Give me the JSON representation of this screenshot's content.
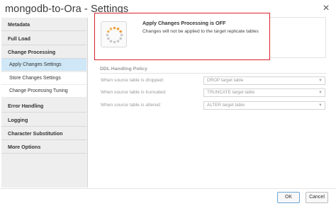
{
  "window": {
    "title": "mongodb-to-Ora - Settings",
    "close_glyph": "×"
  },
  "sidebar": {
    "items": [
      {
        "label": "Metadata"
      },
      {
        "label": "Full Load"
      },
      {
        "label": "Change Processing"
      },
      {
        "label": "Apply Changes Settings",
        "active": true
      },
      {
        "label": "Store Changes Settings"
      },
      {
        "label": "Change Processing Tuning"
      },
      {
        "label": "Error Handling"
      },
      {
        "label": "Logging"
      },
      {
        "label": "Character Substitution"
      },
      {
        "label": "More Options"
      }
    ]
  },
  "notice": {
    "title": "Apply Changes Processing is OFF",
    "message": "Changes will not be applied to the target replicate tables",
    "icon": "spinner-icon",
    "highlight_color": "#d8232a"
  },
  "ddl": {
    "section_title": "DDL Handling Policy",
    "rows": [
      {
        "label": "When source table is dropped:",
        "value": "DROP target table"
      },
      {
        "label": "When source table is truncated:",
        "value": "TRUNCATE target table"
      },
      {
        "label": "When source table is altered:",
        "value": "ALTER target table"
      }
    ]
  },
  "footer": {
    "ok_label": "OK",
    "cancel_label": "Cancel"
  },
  "colors": {
    "active_nav": "#cfe7f7",
    "sidebar_bg": "#eeeeee",
    "ok_border": "#6aa6d6"
  }
}
